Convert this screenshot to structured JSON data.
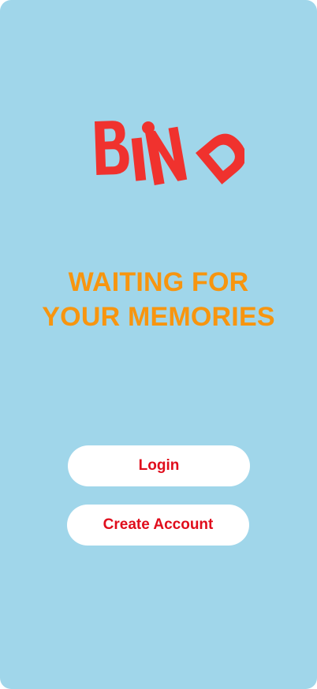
{
  "app": {
    "logo_text": "BIND",
    "tagline_line1": "WAITING FOR",
    "tagline_line2": "YOUR MEMORIES"
  },
  "buttons": {
    "login_label": "Login",
    "create_account_label": "Create Account"
  },
  "colors": {
    "background": "#a0d6ea",
    "brand_red": "#f0322e",
    "tagline_orange": "#f7950f",
    "button_text_red": "#e00d1c",
    "button_bg": "#ffffff"
  }
}
